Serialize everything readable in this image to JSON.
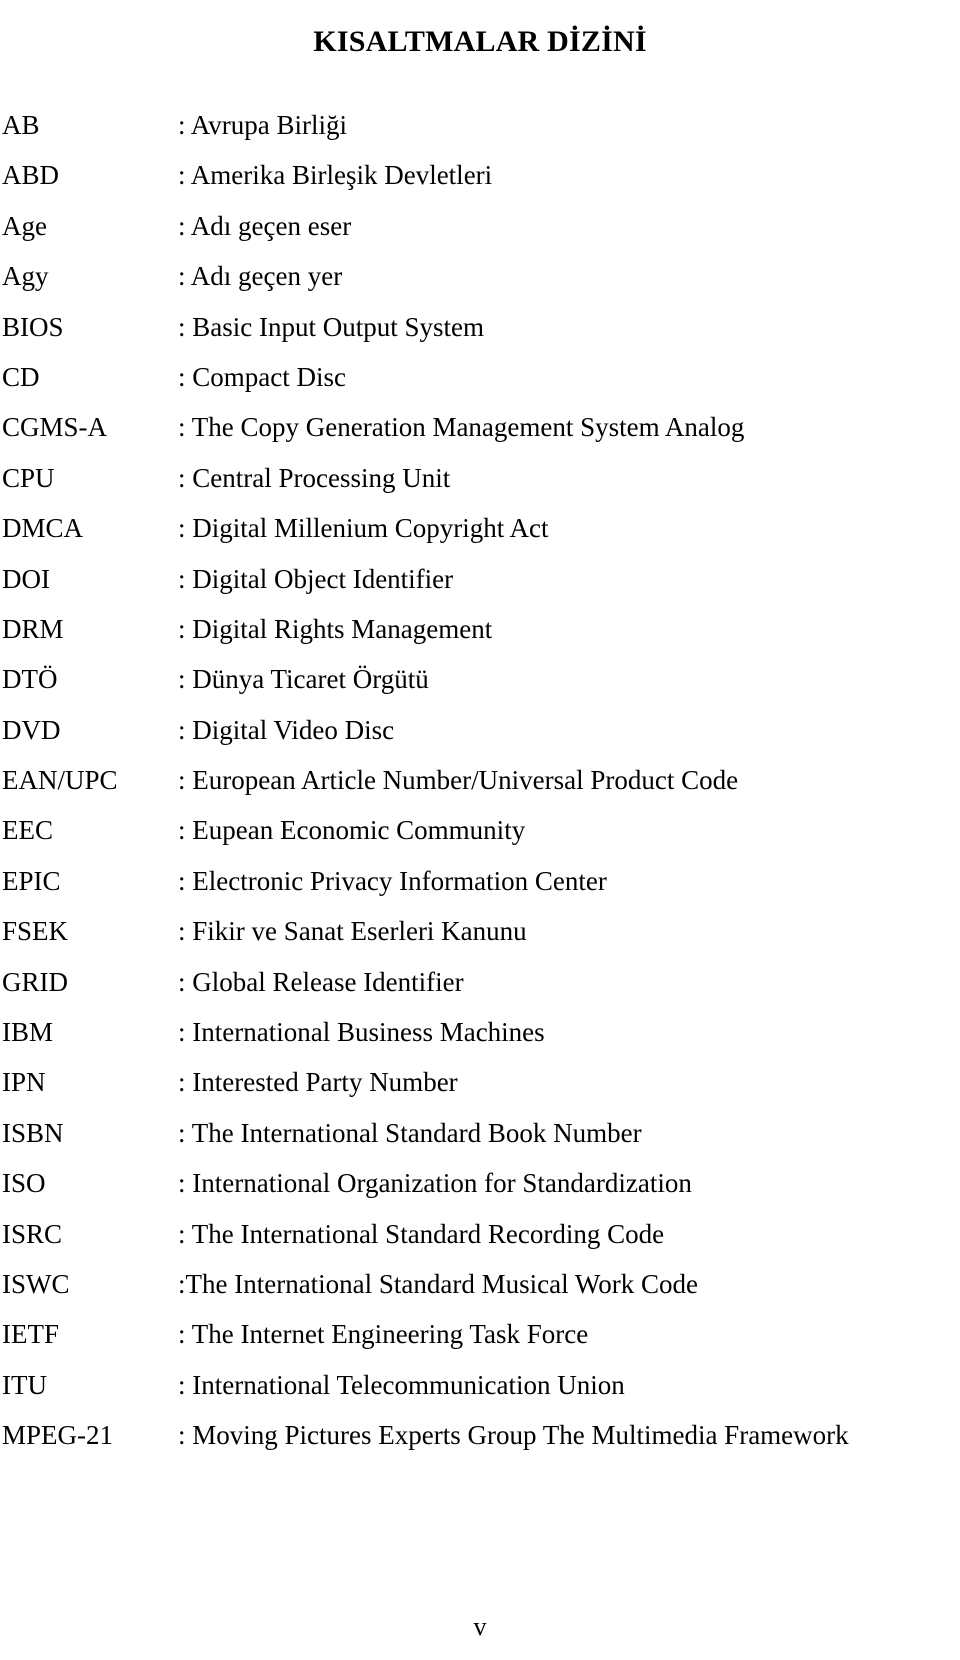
{
  "document": {
    "title": "KISALTMALAR DİZİNİ",
    "page_number": "v"
  },
  "abbreviations": [
    {
      "term": "AB",
      "definition": ": Avrupa Birliği"
    },
    {
      "term": "ABD",
      "definition": ": Amerika Birleşik Devletleri"
    },
    {
      "term": "Age",
      "definition": ": Adı geçen eser"
    },
    {
      "term": "Agy",
      "definition": ": Adı geçen yer"
    },
    {
      "term": "BIOS",
      "definition": ": Basic Input Output System"
    },
    {
      "term": "CD",
      "definition": ": Compact Disc"
    },
    {
      "term": "CGMS-A",
      "definition": ": The Copy Generation Management System Analog"
    },
    {
      "term": "CPU",
      "definition": ": Central Processing Unit"
    },
    {
      "term": "DMCA",
      "definition": ": Digital Millenium Copyright Act"
    },
    {
      "term": "DOI",
      "definition": ": Digital Object Identifier"
    },
    {
      "term": "DRM",
      "definition": ": Digital Rights Management"
    },
    {
      "term": "DTÖ",
      "definition": ": Dünya Ticaret Örgütü"
    },
    {
      "term": "DVD",
      "definition": ": Digital Video Disc"
    },
    {
      "term": "EAN/UPC",
      "definition": ": European Article Number/Universal Product Code"
    },
    {
      "term": "EEC",
      "definition": ": Eupean Economic Community"
    },
    {
      "term": "EPIC",
      "definition": ": Electronic Privacy Information Center"
    },
    {
      "term": "FSEK",
      "definition": ": Fikir ve Sanat Eserleri Kanunu"
    },
    {
      "term": "GRID",
      "definition": ": Global Release Identifier"
    },
    {
      "term": "IBM",
      "definition": ": International Business Machines"
    },
    {
      "term": "IPN",
      "definition": ": Interested Party Number"
    },
    {
      "term": "ISBN",
      "definition": ": The International Standard Book Number"
    },
    {
      "term": "ISO",
      "definition": ": International Organization for Standardization"
    },
    {
      "term": "ISRC",
      "definition": ": The International Standard Recording Code"
    },
    {
      "term": "ISWC",
      "definition": ":The International Standard Musical Work Code"
    },
    {
      "term": "IETF",
      "definition": ": The Internet Engineering Task Force"
    },
    {
      "term": "ITU",
      "definition": ": International Telecommunication Union"
    },
    {
      "term": "MPEG-21",
      "definition": ": Moving Pictures Experts Group The Multimedia Framework"
    }
  ]
}
